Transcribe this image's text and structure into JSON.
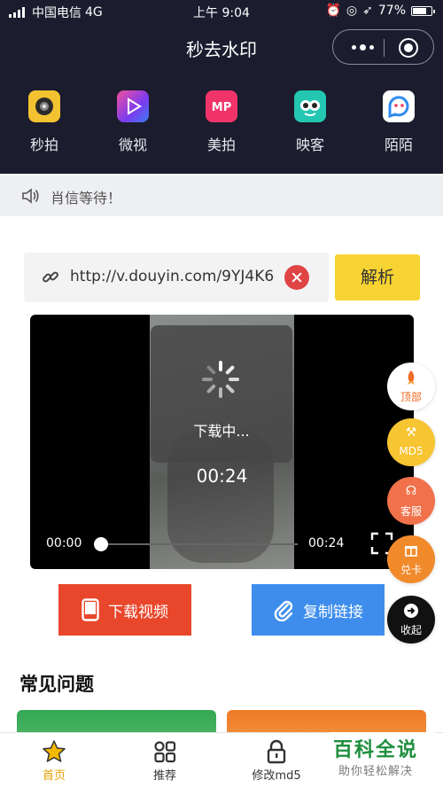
{
  "status_bar": {
    "carrier": "中国电信",
    "network": "4G",
    "time": "上午 9:04",
    "battery": "77%",
    "battery_level": 0.77
  },
  "nav": {
    "title": "秒去水印"
  },
  "platforms": [
    {
      "label": "秒拍",
      "icon": "miaopai-icon",
      "color": "#2a2a2a",
      "accent": "#f2c230"
    },
    {
      "label": "微视",
      "icon": "weishi-icon",
      "color": "#7b3cf0",
      "accent": "#f04fa0"
    },
    {
      "label": "美拍",
      "icon": "meipai-icon",
      "color": "#f0346a",
      "accent": "#ff5a8a"
    },
    {
      "label": "映客",
      "icon": "yingke-icon",
      "color": "#23c6b0",
      "accent": "#ffffff"
    },
    {
      "label": "陌陌",
      "icon": "momo-icon",
      "color": "#ffffff",
      "accent": "#2e8cf0"
    }
  ],
  "notice": {
    "text": "肖信等待！"
  },
  "url_input": {
    "value": "http://v.douyin.com/9YJ4K6"
  },
  "parse_button": {
    "label": "解析"
  },
  "video": {
    "loading_text": "下载中...",
    "big_time": "00:24",
    "current_time": "00:00",
    "duration": "00:24",
    "progress": 0.0
  },
  "actions": {
    "download_label": "下载视频",
    "copy_label": "复制链接"
  },
  "side_buttons": [
    {
      "label": "顶部",
      "icon": "rocket-icon",
      "color": "#ffffff",
      "text_color": "#ef6a25"
    },
    {
      "label": "MD5",
      "icon": "wrench-icon",
      "color": "#f7c531",
      "text_color": "#ffffff"
    },
    {
      "label": "客服",
      "icon": "headset-icon",
      "color": "#f0714a",
      "text_color": "#ffffff"
    },
    {
      "label": "兑卡",
      "icon": "gift-icon",
      "color": "#f18a2b",
      "text_color": "#ffffff"
    },
    {
      "label": "收起",
      "icon": "arrow-right-icon",
      "color": "#111111",
      "text_color": "#ffffff"
    }
  ],
  "faq": {
    "title": "常见问题"
  },
  "tabs": [
    {
      "label": "首页",
      "icon": "star-icon",
      "active": true
    },
    {
      "label": "推荐",
      "icon": "grid-icon",
      "active": false
    },
    {
      "label": "修改md5",
      "icon": "lock-icon",
      "active": false
    }
  ],
  "watermark": {
    "title": "百科全说",
    "subtitle": "助你轻松解决"
  },
  "colors": {
    "header_bg": "#1b1c2e",
    "accent_yellow": "#f7d333",
    "download_red": "#e8472b",
    "copy_blue": "#3e8ded"
  }
}
